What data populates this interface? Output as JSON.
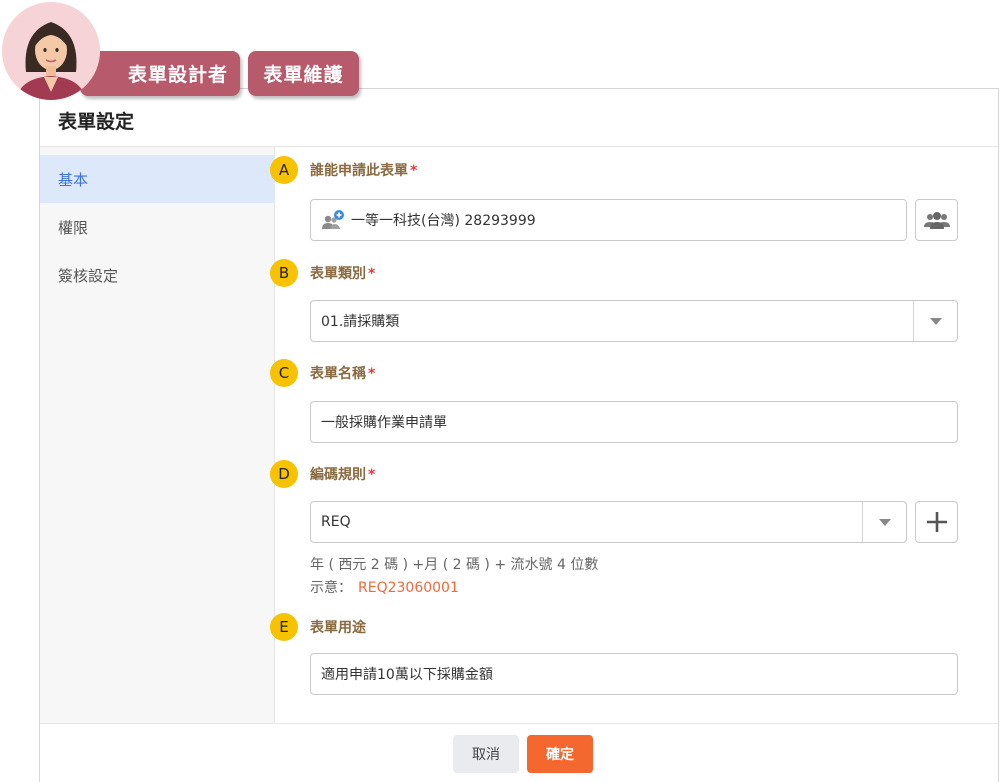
{
  "roles": [
    "表單設計者",
    "表單維護"
  ],
  "dialog": {
    "title": "表單設定"
  },
  "sidebar": {
    "items": [
      {
        "label": "基本",
        "active": true
      },
      {
        "label": "權限",
        "active": false
      },
      {
        "label": "簽核設定",
        "active": false
      }
    ]
  },
  "fields": {
    "a": {
      "badge": "A",
      "label": "誰能申請此表單",
      "required": "*",
      "value": "一等一科技(台灣)  28293999"
    },
    "b": {
      "badge": "B",
      "label": "表單類別",
      "required": "*",
      "value": "01.請採購類"
    },
    "c": {
      "badge": "C",
      "label": "表單名稱",
      "required": "*",
      "value": "一般採購作業申請單"
    },
    "d": {
      "badge": "D",
      "label": "編碼規則",
      "required": "*",
      "value": "REQ",
      "rule": "年 ( 西元 2 碼 ) +月 ( 2 碼 ) + 流水號 4 位數",
      "example_label": "示意：",
      "example_value": "REQ23060001"
    },
    "e": {
      "badge": "E",
      "label": "表單用途",
      "value": "適用申請10萬以下採購金額"
    }
  },
  "footer": {
    "cancel": "取消",
    "ok": "確定"
  },
  "colors": {
    "accent": "#f4672f",
    "badge": "#f7c200",
    "role_tag": "#b75a6c",
    "label": "#8a6a40",
    "active_nav": "#3d74d6"
  }
}
